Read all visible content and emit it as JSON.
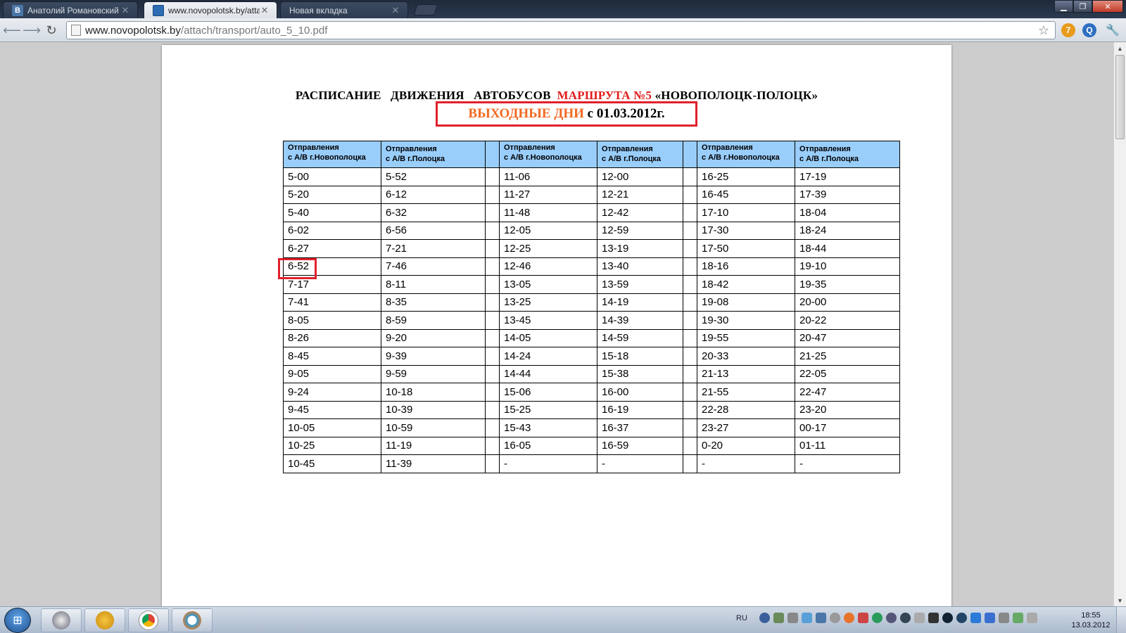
{
  "browser": {
    "tabs": [
      {
        "title": "Анатолий Романовский",
        "favicon": "vk-icon",
        "active": false
      },
      {
        "title": "www.novopolotsk.by/atta",
        "favicon": "site-icon",
        "active": true
      },
      {
        "title": "Новая вкладка",
        "favicon": "",
        "active": false
      }
    ],
    "url_host": "www.novopolotsk.by",
    "url_path": "/attach/transport/auto_5_10.pdf",
    "extensions": [
      "7",
      "Q"
    ]
  },
  "document": {
    "title_black1": "РАСПИСАНИЕ   ДВИЖЕНИЯ   АВТОБУСОВ  ",
    "title_red": "МАРШРУТА №5",
    "title_black2": " «НОВОПОЛОЦК-ПОЛОЦК»",
    "subtitle_orange": "ВЫХОДНЫЕ ДНИ",
    "subtitle_black": " с 01.03.2012г.",
    "columns": [
      {
        "line1": "Отправления",
        "line2": "с А/В г.Новополоцка"
      },
      {
        "line1": "Отправления",
        "line2": "с А/В г.Полоцка"
      },
      {
        "line1": "Отправления",
        "line2": "с А/В г.Новополоцка"
      },
      {
        "line1": "Отправления",
        "line2": "с А/В г.Полоцка"
      },
      {
        "line1": "Отправления",
        "line2": "с А/В г.Новополоцка"
      },
      {
        "line1": "Отправления",
        "line2": "с А/В г.Полоцка"
      }
    ],
    "rows": [
      [
        "5-00",
        "5-52",
        "11-06",
        "12-00",
        "16-25",
        "17-19"
      ],
      [
        "5-20",
        "6-12",
        "11-27",
        "12-21",
        "16-45",
        "17-39"
      ],
      [
        "5-40",
        "6-32",
        "11-48",
        "12-42",
        "17-10",
        "18-04"
      ],
      [
        "6-02",
        "6-56",
        "12-05",
        "12-59",
        "17-30",
        "18-24"
      ],
      [
        "6-27",
        "7-21",
        "12-25",
        "13-19",
        "17-50",
        "18-44"
      ],
      [
        "6-52",
        "7-46",
        "12-46",
        "13-40",
        "18-16",
        "19-10"
      ],
      [
        "7-17",
        "8-11",
        "13-05",
        "13-59",
        "18-42",
        "19-35"
      ],
      [
        "7-41",
        "8-35",
        "13-25",
        "14-19",
        "19-08",
        "20-00"
      ],
      [
        "8-05",
        "8-59",
        "13-45",
        "14-39",
        "19-30",
        "20-22"
      ],
      [
        "8-26",
        "9-20",
        "14-05",
        "14-59",
        "19-55",
        "20-47"
      ],
      [
        "8-45",
        "9-39",
        "14-24",
        "15-18",
        "20-33",
        "21-25"
      ],
      [
        "9-05",
        "9-59",
        "14-44",
        "15-38",
        "21-13",
        "22-05"
      ],
      [
        "9-24",
        "10-18",
        "15-06",
        "16-00",
        "21-55",
        "22-47"
      ],
      [
        "9-45",
        "10-39",
        "15-25",
        "16-19",
        "22-28",
        "23-20"
      ],
      [
        "10-05",
        "10-59",
        "15-43",
        "16-37",
        "23-27",
        "00-17"
      ],
      [
        "10-25",
        "11-19",
        "16-05",
        "16-59",
        "0-20",
        "01-11"
      ],
      [
        "10-45",
        "11-39",
        "-",
        "-",
        "-",
        "-"
      ]
    ],
    "highlighted_cell": "6-52"
  },
  "taskbar": {
    "lang": "RU",
    "time": "18:55",
    "date": "13.03.2012"
  },
  "colors": {
    "title_red": "#e21b1b",
    "subtitle_orange": "#f16a22",
    "header_blue": "#99cdfa",
    "highlight_red": "#e0202c"
  }
}
